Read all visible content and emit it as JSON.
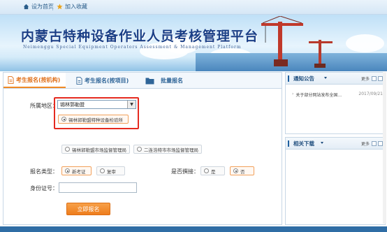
{
  "topbar": {
    "home_label": "设为首页",
    "favorite_label": "加入收藏"
  },
  "banner": {
    "title_cn": "内蒙古特种设备作业人员考核管理平台",
    "title_en": "Neimenggu Special Equipment Operators Assessment & Management Platform"
  },
  "tabs": [
    {
      "label": "考生报名(按机构)",
      "active": true
    },
    {
      "label": "考生报名(按项目)",
      "active": false
    },
    {
      "label": "批量报名",
      "active": false
    }
  ],
  "form": {
    "region_label": "所属地区：",
    "region_value": "锡林郭勒盟",
    "institutions": [
      {
        "label": "锡林郭勒盟特种设备检验所",
        "selected": true
      },
      {
        "label": "锡林郭勒盟市场监督管理局",
        "selected": false
      },
      {
        "label": "二连浩特市市场监督管理局",
        "selected": false
      }
    ],
    "reg_type_label": "报名类型：",
    "reg_type_options": [
      {
        "label": "新考证",
        "selected": true
      },
      {
        "label": "复审",
        "selected": false
      }
    ],
    "repeat_label": "是否撰接：",
    "repeat_options": [
      {
        "label": "是",
        "selected": false
      },
      {
        "label": "否",
        "selected": true
      }
    ],
    "id_label": "身份证号：",
    "id_value": "",
    "submit_label": "立即报名"
  },
  "notice_panel": {
    "title": "通知公告",
    "more_label": "更多",
    "items": [
      {
        "text": "关于部分网站发布全国...",
        "date": "2017/09/21"
      }
    ]
  },
  "download_panel": {
    "title": "相关下载",
    "more_label": "更多"
  },
  "colors": {
    "accent_orange": "#ee7d1d",
    "highlight_red": "#e52a1f",
    "title_blue": "#1b3f86",
    "footer_blue": "#2f6da5"
  }
}
